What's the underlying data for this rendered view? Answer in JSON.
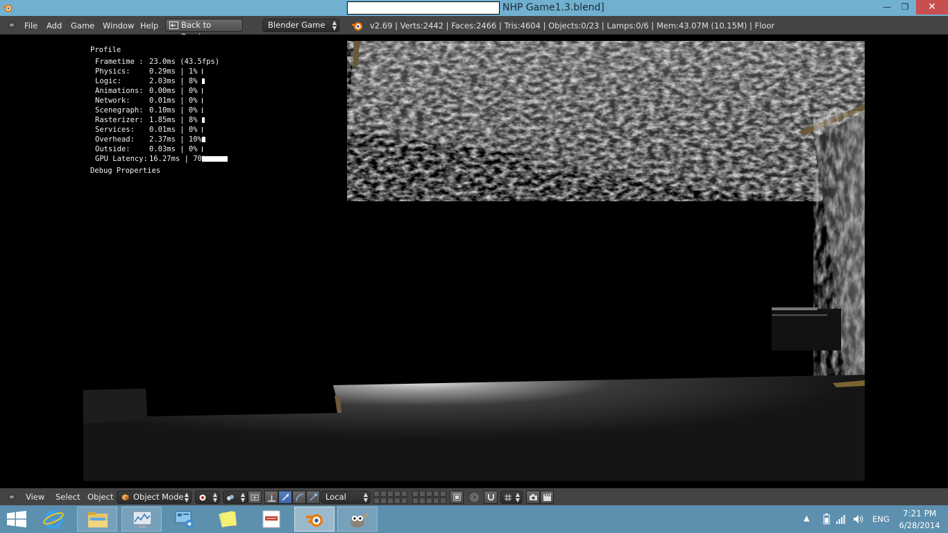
{
  "window": {
    "title_visible": "NHP Game1.3.blend]",
    "minimize_glyph": "—",
    "restore_glyph": "❐",
    "close_glyph": "✕"
  },
  "menubar": {
    "items": [
      "File",
      "Add",
      "Game",
      "Window",
      "Help"
    ],
    "back_button": "Back to Previous",
    "engine": "Blender Game",
    "stats": "v2.69 | Verts:2442 | Faces:2466 | Tris:4604 | Objects:0/23 | Lamps:0/6 | Mem:43.07M (10.15M) | Floor"
  },
  "profile": {
    "title": "Profile",
    "rows": [
      {
        "name": "Frametime :",
        "value": "23.0ms (43.5fps)",
        "percent": null
      },
      {
        "name": "Physics:",
        "value": "0.29ms | 1%",
        "percent": 1
      },
      {
        "name": "Logic:",
        "value": "2.03ms | 8%",
        "percent": 8
      },
      {
        "name": "Animations:",
        "value": "0.00ms | 0%",
        "percent": 0
      },
      {
        "name": "Network:",
        "value": "0.01ms | 0%",
        "percent": 0
      },
      {
        "name": "Scenegraph:",
        "value": "0.10ms | 0%",
        "percent": 0
      },
      {
        "name": "Rasterizer:",
        "value": "1.85ms | 8%",
        "percent": 8
      },
      {
        "name": "Services:",
        "value": "0.01ms | 0%",
        "percent": 0
      },
      {
        "name": "Overhead:",
        "value": "2.37ms | 10%",
        "percent": 10
      },
      {
        "name": "Outside:",
        "value": "0.03ms | 0%",
        "percent": 0
      },
      {
        "name": "GPU Latency:",
        "value": "16.27ms | 70%",
        "percent": 70
      }
    ],
    "debug": "Debug Properties"
  },
  "view3d_header": {
    "menus": [
      "View",
      "Select",
      "Object"
    ],
    "mode": "Object Mode",
    "orientation": "Local"
  },
  "taskbar": {
    "apps": [
      "internet-explorer",
      "file-explorer",
      "resource-monitor",
      "control-panel",
      "sticky-notes",
      "pdf-reader",
      "blender",
      "gimp"
    ],
    "active_app": "blender",
    "language": "ENG",
    "time": "7:21 PM",
    "date": "6/28/2014"
  },
  "colors": {
    "titlebar": "#71b0cf",
    "close": "#c74f50",
    "header": "#444444",
    "taskbar": "#5d8fae",
    "blender_orange": "#e87d0d"
  }
}
